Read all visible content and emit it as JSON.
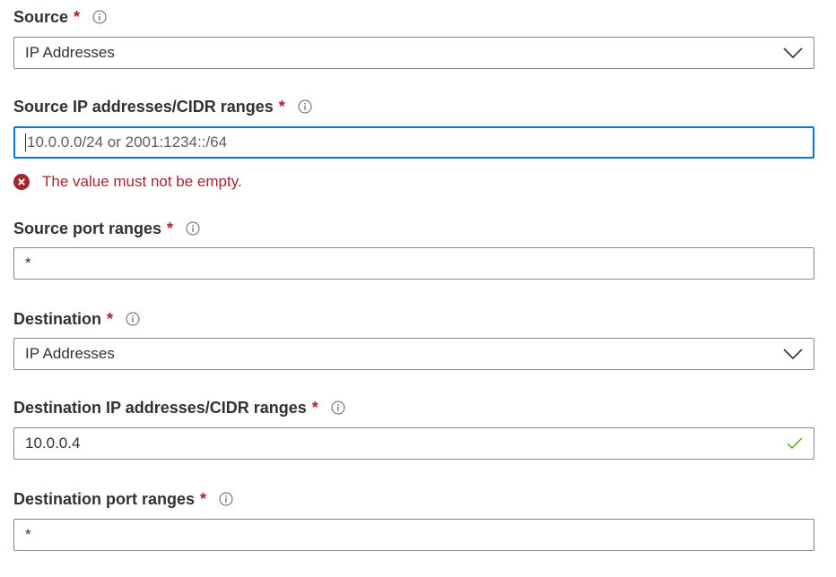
{
  "source": {
    "label": "Source",
    "required_mark": "*",
    "selected_value": "IP Addresses"
  },
  "source_ip": {
    "label": "Source IP addresses/CIDR ranges",
    "required_mark": "*",
    "value": "",
    "placeholder": "10.0.0.0/24 or 2001:1234::/64",
    "error": "The value must not be empty."
  },
  "source_port": {
    "label": "Source port ranges",
    "required_mark": "*",
    "value": "*"
  },
  "destination": {
    "label": "Destination",
    "required_mark": "*",
    "selected_value": "IP Addresses"
  },
  "destination_ip": {
    "label": "Destination IP addresses/CIDR ranges",
    "required_mark": "*",
    "value": "10.0.0.4"
  },
  "destination_port": {
    "label": "Destination port ranges",
    "required_mark": "*",
    "value": "*"
  },
  "colors": {
    "required": "#a4262c",
    "error": "#a4262c",
    "focus_border": "#0078d4",
    "valid_check": "#57a300",
    "border": "#8a8886"
  },
  "icons": {
    "info": "info-icon",
    "dropdown": "chevron-down-icon",
    "error": "error-circle-icon",
    "valid": "checkmark-icon"
  }
}
